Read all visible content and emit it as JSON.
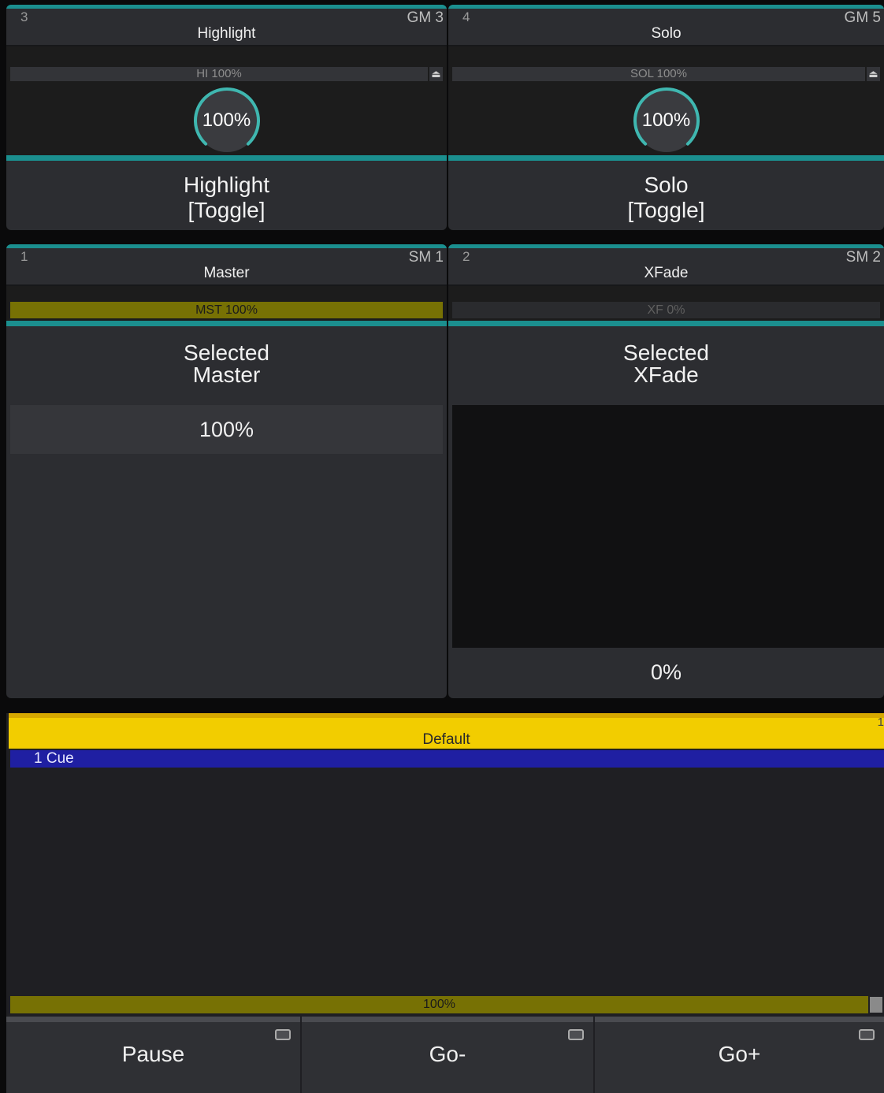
{
  "colors": {
    "teal": "#1b8f8f",
    "olive_fill": "#777104",
    "sequence_header": "#f2cd00",
    "cue_highlight": "#1f1fa2"
  },
  "grand_masters": [
    {
      "number": "3",
      "id": "GM 3",
      "title": "Highlight",
      "bar_text": "HI  100%",
      "knob_value": "100%",
      "knob_fraction": 1.0,
      "button_line1": "Highlight",
      "button_line2": "[Toggle]",
      "eject_icon": "eject-icon"
    },
    {
      "number": "4",
      "id": "GM 5",
      "title": "Solo",
      "bar_text": "SOL  100%",
      "knob_value": "100%",
      "knob_fraction": 1.0,
      "button_line1": "Solo",
      "button_line2": "[Toggle]",
      "eject_icon": "eject-icon"
    }
  ],
  "special_masters": [
    {
      "number": "1",
      "id": "SM 1",
      "title": "Master",
      "bar_text": "MST  100%",
      "level_fraction": 1.0,
      "button_line1": "Selected",
      "button_line2": "Master",
      "value": "100%"
    },
    {
      "number": "2",
      "id": "SM 2",
      "title": "XFade",
      "bar_text": "XF  0%",
      "level_fraction": 0.0,
      "button_line1": "Selected",
      "button_line2": "XFade",
      "value": "0%"
    }
  ],
  "sequence": {
    "number": "1",
    "title": "Default",
    "cues": [
      {
        "label": "1  Cue"
      }
    ],
    "level_text": "100%",
    "level_fraction": 1.0,
    "buttons": [
      {
        "label": "Pause"
      },
      {
        "label": "Go-"
      },
      {
        "label": "Go+"
      }
    ]
  }
}
